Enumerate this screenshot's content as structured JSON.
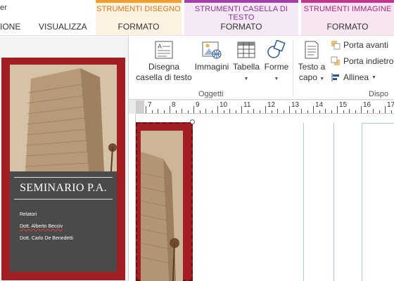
{
  "tabs": {
    "fragment_left": "er",
    "tab_view_fragment": "IONE",
    "tab_visualizza": "VISUALIZZA",
    "drawing_tools": {
      "caption": "STRUMENTI DISEGNO",
      "tab": "FORMATO",
      "color": "#f0a030"
    },
    "textbox_tools": {
      "caption": "STRUMENTI CASELLA DI TESTO",
      "tab": "FORMATO",
      "color": "#a23fa8"
    },
    "image_tools": {
      "caption": "STRUMENTI IMMAGINE",
      "tab": "FORMATO",
      "color": "#c1378c"
    }
  },
  "ribbon": {
    "text_box_label_line1": "Disegna",
    "text_box_label_line2": "casella di testo",
    "images_label": "Immagini",
    "table_label": "Tabella",
    "shapes_label": "Forme",
    "group_objects": "Oggetti",
    "wrap_text_line1": "Testo a",
    "wrap_text_line2": "capo",
    "bring_forward": "Porta avanti",
    "send_backward": "Porta indietro",
    "align": "Allinea",
    "group_arrange": "Dispo",
    "font_fragment": "A"
  },
  "ruler": {
    "labels": [
      "7",
      "8",
      "9",
      "10",
      "11",
      "12",
      "13",
      "14",
      "15",
      "16",
      "17"
    ]
  },
  "thumbnail": {
    "title": "SEMINARIO P.A.",
    "relatori": "Relatori",
    "speaker1": "Dott. Alberto Becciv",
    "speaker2": "Dott. Carlo De Benedetti"
  },
  "colors": {
    "brochure_red": "#a11f22",
    "panel_dark": "#4a4a4a",
    "guide_blue": "#9ecbe8"
  }
}
